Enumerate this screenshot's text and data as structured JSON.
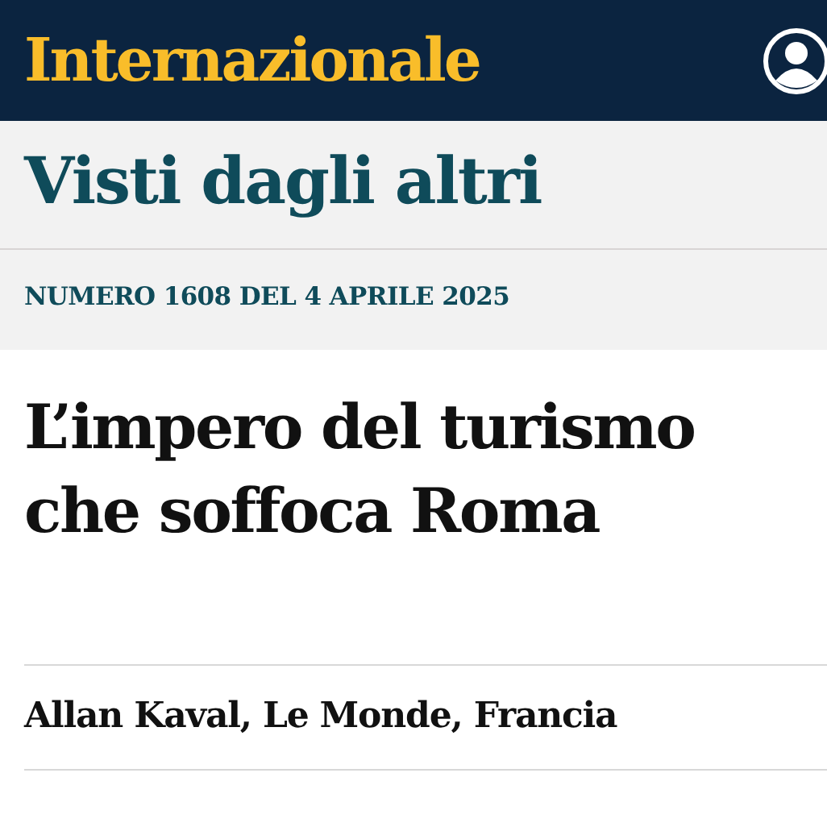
{
  "header": {
    "logo": "Internazionale"
  },
  "section": {
    "title": "Visti dagli altri",
    "issue": "NUMERO 1608 DEL 4 APRILE 2025"
  },
  "article": {
    "headline": "L’impero del turismo che soffoca Roma",
    "byline": "Allan Kaval, Le Monde, Francia"
  }
}
